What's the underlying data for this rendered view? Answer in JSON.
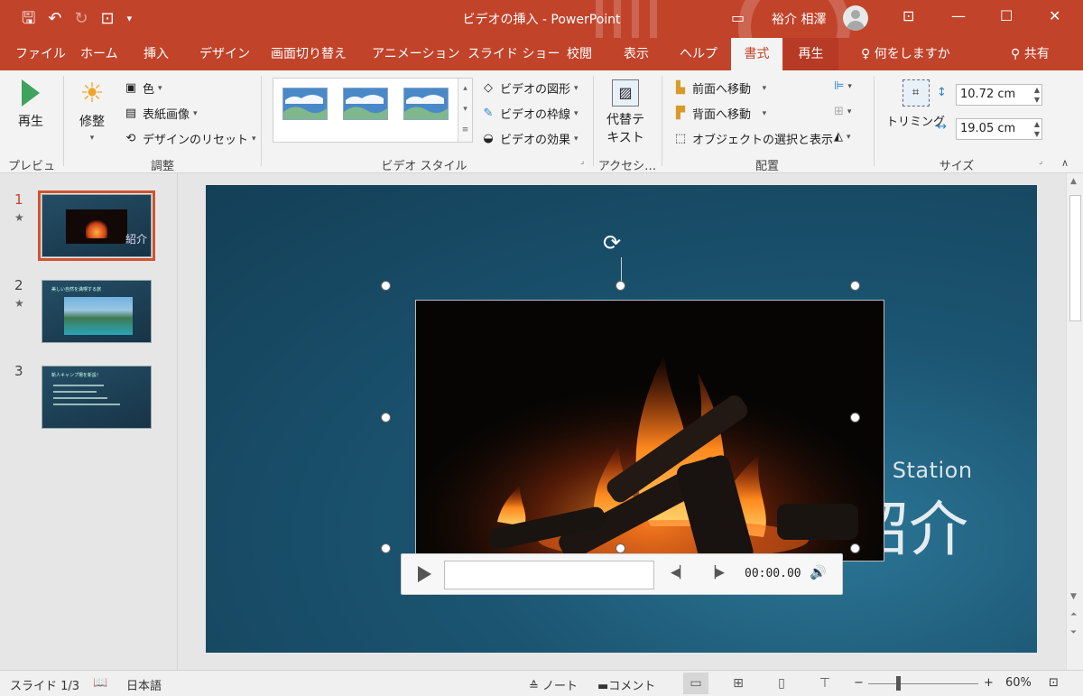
{
  "window": {
    "title": "ビデオの挿入 - PowerPoint",
    "user": "裕介 相澤"
  },
  "tabs": [
    "ファイル",
    "ホーム",
    "挿入",
    "デザイン",
    "画面切り替え",
    "アニメーション",
    "スライド ショー",
    "校閲",
    "表示",
    "ヘルプ",
    "書式",
    "再生"
  ],
  "tell_me": "何をしますか",
  "share": "共有",
  "ribbon": {
    "preview": {
      "play": "再生",
      "group": "プレビュー"
    },
    "adjust": {
      "corrections": "修整",
      "color": "色",
      "poster_frame": "表紙画像",
      "reset_design": "デザインのリセット",
      "group": "調整"
    },
    "video_styles": {
      "shape": "ビデオの図形",
      "border": "ビデオの枠線",
      "effects": "ビデオの効果",
      "group": "ビデオ スタイル"
    },
    "accessibility": {
      "alt_text_line1": "代替テ",
      "alt_text_line2": "キスト",
      "group": "アクセシ…"
    },
    "arrange": {
      "bring_forward": "前面へ移動",
      "send_backward": "背面へ移動",
      "selection_pane": "オブジェクトの選択と表示",
      "group": "配置"
    },
    "size": {
      "crop": "トリミング",
      "height": "10.72 cm",
      "width": "19.05 cm",
      "group": "サイズ"
    }
  },
  "slides": [
    {
      "number": "1",
      "star": "★"
    },
    {
      "number": "2",
      "star": "★",
      "mini_title": "美しい自然を満喫する旅"
    },
    {
      "number": "3",
      "mini_title": "新人キャンプ場を新設！"
    }
  ],
  "slide": {
    "subtitle": "mp Station",
    "title": "紹介",
    "thumb_text": "紹介"
  },
  "player": {
    "time": "00:00.00"
  },
  "status": {
    "slide": "スライド 1/3",
    "language": "日本語",
    "notes": "ノート",
    "comments": "コメント",
    "zoom": "60%"
  },
  "colors": {
    "accent": "#c1432a",
    "slide_bg": "#1b5572"
  }
}
